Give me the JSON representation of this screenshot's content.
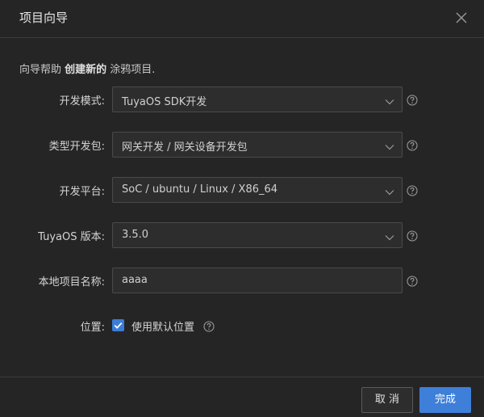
{
  "dialog": {
    "title": "项目向导",
    "intro_before": "向导帮助 ",
    "intro_bold": "创建新的",
    "intro_after": " 涂鸦项目."
  },
  "form": {
    "dev_mode_label": "开发模式:",
    "dev_mode_value": "TuyaOS SDK开发",
    "pkg_type_label": "类型开发包:",
    "pkg_type_value": "网关开发 / 网关设备开发包",
    "platform_label": "开发平台:",
    "platform_value": "SoC / ubuntu / Linux / X86_64",
    "version_label": "TuyaOS 版本:",
    "version_value": "3.5.0",
    "project_name_label": "本地项目名称:",
    "project_name_value": "aaaa",
    "location_label": "位置:",
    "use_default_location_label": "使用默认位置",
    "use_default_location_checked": true
  },
  "footer": {
    "cancel_label": "取 消",
    "finish_label": "完成"
  },
  "colors": {
    "background": "#252526",
    "accent": "#3e7fd9"
  },
  "icons": {
    "close": "close-icon",
    "dropdown": "chevron-down-icon",
    "help": "help-icon",
    "check": "check-icon"
  }
}
